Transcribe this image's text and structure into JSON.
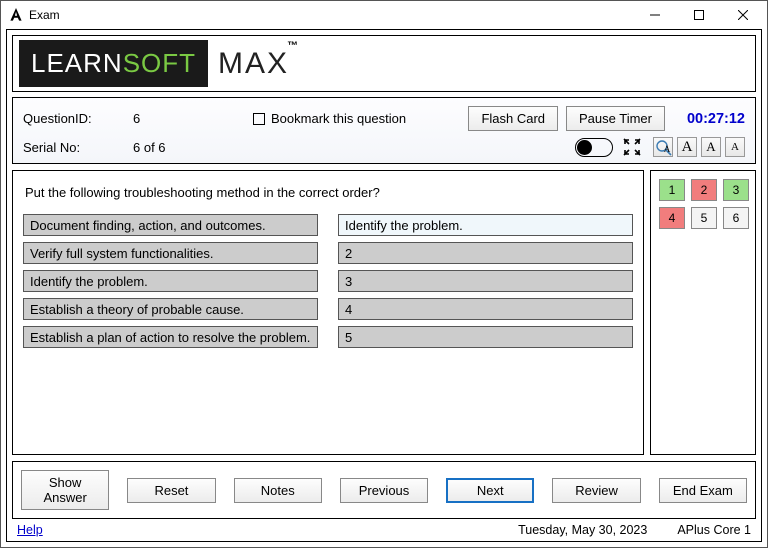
{
  "window": {
    "title": "Exam"
  },
  "logo": {
    "part1": "LEARN",
    "part2": "SOFT",
    "part3": "MAX",
    "tm": "™"
  },
  "info": {
    "question_id_label": "QuestionID:",
    "question_id_value": "6",
    "serial_label": "Serial No:",
    "serial_value": "6 of 6",
    "bookmark_label": "Bookmark this question",
    "flash_card_btn": "Flash Card",
    "pause_timer_btn": "Pause Timer",
    "timer": "00:27:12"
  },
  "font_buttons": {
    "mag": "A",
    "large": "A",
    "med": "A",
    "small": "A"
  },
  "question": {
    "text": "Put the following troubleshooting method in the correct order?",
    "left_options": [
      "Document finding, action, and outcomes.",
      "Verify full system functionalities.",
      "Identify the problem.",
      "Establish a theory of probable cause.",
      "Establish a plan of action to resolve the problem."
    ],
    "right_options": [
      "Identify the problem.",
      "2",
      "3",
      "4",
      "5"
    ]
  },
  "nav_buttons": [
    {
      "n": "1",
      "state": "green"
    },
    {
      "n": "2",
      "state": "red"
    },
    {
      "n": "3",
      "state": "green"
    },
    {
      "n": "4",
      "state": "red"
    },
    {
      "n": "5",
      "state": "plain"
    },
    {
      "n": "6",
      "state": "plain"
    }
  ],
  "bottom": {
    "show_answer": "Show Answer",
    "reset": "Reset",
    "notes": "Notes",
    "previous": "Previous",
    "next": "Next",
    "review": "Review",
    "end_exam": "End Exam"
  },
  "status": {
    "help": "Help",
    "date": "Tuesday, May 30, 2023",
    "exam": "APlus Core 1"
  }
}
